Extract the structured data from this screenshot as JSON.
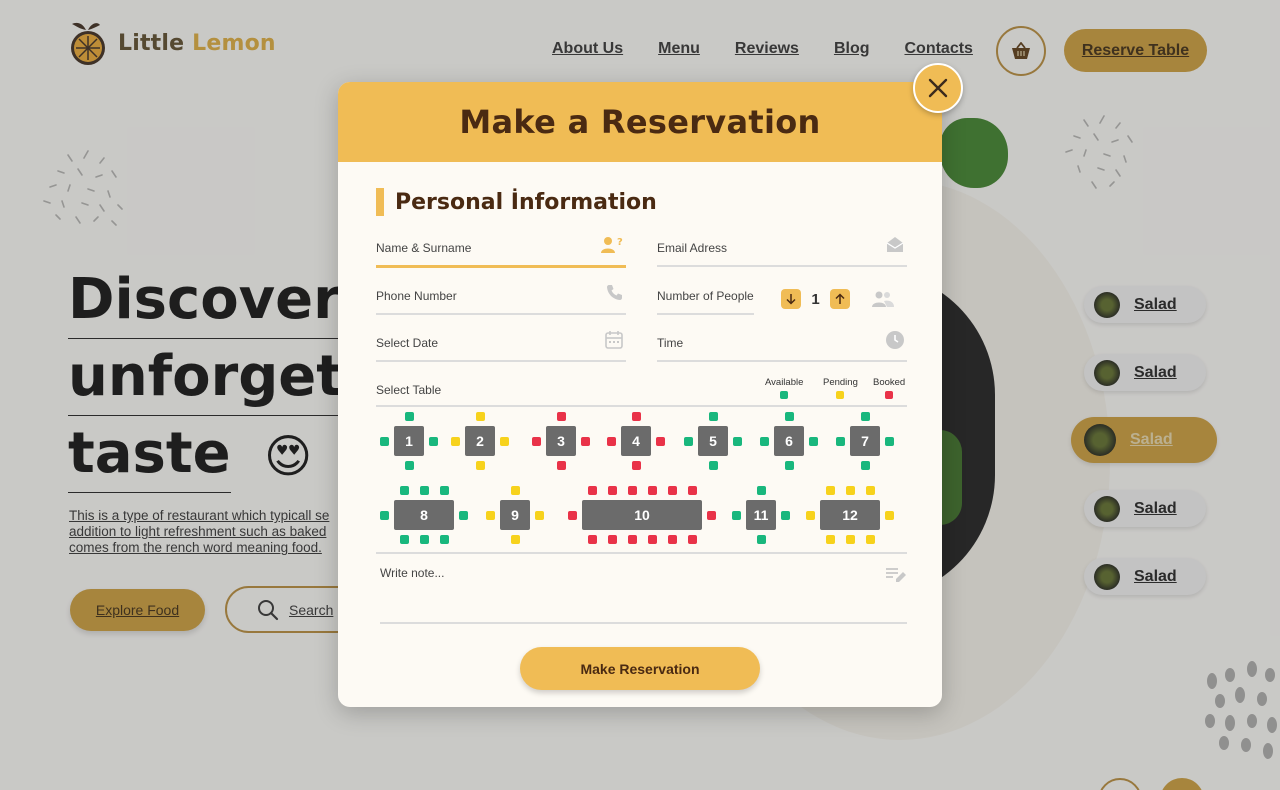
{
  "brand": {
    "name_part1": "Little",
    "name_part2": "Lemon"
  },
  "nav": {
    "items": [
      "About Us",
      "Menu",
      "Reviews",
      "Blog",
      "Contacts"
    ]
  },
  "header": {
    "reserve_label": "Reserve Table",
    "cart_icon": "basket-icon"
  },
  "hero": {
    "title_lines": [
      "Discover t",
      "unforgett",
      "taste"
    ],
    "emoji": "😍",
    "description": "This is a type of restaurant which typicall se addition to light refreshment such as baked comes from the rench word meaning food.",
    "explore_label": "Explore Food",
    "search_label": "Search"
  },
  "side_menu": {
    "items": [
      "Salad",
      "Salad",
      "Salad",
      "Salad",
      "Salad"
    ],
    "active_index": 2
  },
  "modal": {
    "title": "Make a Reservation",
    "close_icon": "close-icon",
    "section_title": "Personal İnformation",
    "fields": {
      "name": "Name & Surname",
      "email": "Email Adress",
      "phone": "Phone Number",
      "people": "Number of People",
      "date": "Select Date",
      "time": "Time",
      "table": "Select Table",
      "note": "Write note..."
    },
    "people_count": "1",
    "legend": [
      {
        "label": "Available",
        "color": "#19b77d"
      },
      {
        "label": "Pending",
        "color": "#f7d21c"
      },
      {
        "label": "Booked",
        "color": "#e93248"
      }
    ],
    "tables": [
      "1",
      "2",
      "3",
      "4",
      "5",
      "6",
      "7",
      "8",
      "9",
      "10",
      "11",
      "12"
    ],
    "submit_label": "Make Reservation"
  },
  "colors": {
    "accent": "#f0bc55",
    "available": "#19b77d",
    "pending": "#f7d21c",
    "booked": "#e93248",
    "table": "#6b6b6b"
  }
}
